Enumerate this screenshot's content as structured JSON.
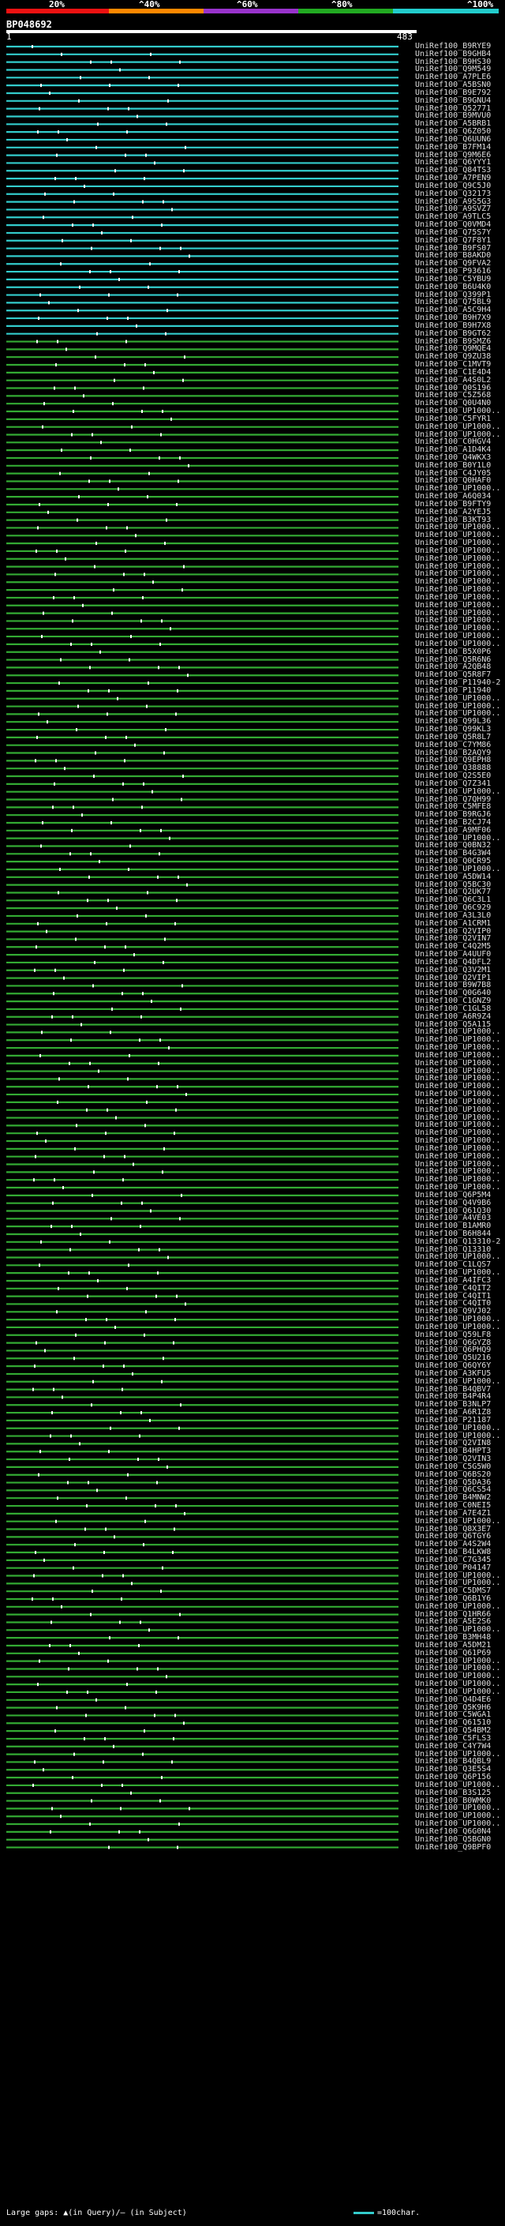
{
  "scale": {
    "labels": [
      "20%",
      "^40%",
      "^60%",
      "^80%",
      "^100%"
    ],
    "colors": [
      "#ee1111",
      "#ff8800",
      "#9933cc",
      "#22aa22",
      "#22cccc"
    ]
  },
  "query": {
    "id": "BP048692",
    "start": "1",
    "end": "483"
  },
  "colors": {
    "cyan": "#33cccc",
    "green": "#33aa33",
    "gap": "#ffffff",
    "arrow_pink": "#dd55dd",
    "arrow_green": "#44cc44"
  },
  "hits": [
    {
      "label": "UniRef100_B9RYE9",
      "c": "cyan"
    },
    {
      "label": "UniRef100_B9GHB4",
      "c": "cyan"
    },
    {
      "label": "UniRef100_B9HS30",
      "c": "cyan"
    },
    {
      "label": "UniRef100_Q9M549",
      "c": "cyan"
    },
    {
      "label": "UniRef100_A7PLE6",
      "c": "cyan"
    },
    {
      "label": "UniRef100_A5BSN0",
      "c": "cyan"
    },
    {
      "label": "UniRef100_B9E792",
      "c": "cyan"
    },
    {
      "label": "UniRef100_B9GNU4",
      "c": "cyan"
    },
    {
      "label": "UniRef100_Q52771",
      "c": "cyan"
    },
    {
      "label": "UniRef100_B9MVU0",
      "c": "cyan"
    },
    {
      "label": "UniRef100_A5BRB1",
      "c": "cyan"
    },
    {
      "label": "UniRef100_Q6Z050",
      "c": "cyan"
    },
    {
      "label": "UniRef100_Q6UUN6",
      "c": "cyan"
    },
    {
      "label": "UniRef100_B7FM14",
      "c": "cyan"
    },
    {
      "label": "UniRef100_Q9M6E6",
      "c": "cyan"
    },
    {
      "label": "UniRef100_Q6YYY1",
      "c": "cyan"
    },
    {
      "label": "UniRef100_Q84TS3",
      "c": "cyan"
    },
    {
      "label": "UniRef100_A7PEN9",
      "c": "cyan"
    },
    {
      "label": "UniRef100_Q9C5J0",
      "c": "cyan"
    },
    {
      "label": "UniRef100_Q32173",
      "c": "cyan"
    },
    {
      "label": "UniRef100_A9S5G3",
      "c": "cyan"
    },
    {
      "label": "UniRef100_A9SVZ7",
      "c": "cyan"
    },
    {
      "label": "UniRef100_A9TLC5",
      "c": "cyan"
    },
    {
      "label": "UniRef100_Q0VMD4",
      "c": "cyan"
    },
    {
      "label": "UniRef100_Q75S7Y",
      "c": "cyan"
    },
    {
      "label": "UniRef100_Q7F8Y1",
      "c": "cyan"
    },
    {
      "label": "UniRef100_B9FS07",
      "c": "cyan"
    },
    {
      "label": "UniRef100_B8AKD0",
      "c": "cyan"
    },
    {
      "label": "UniRef100_Q9FVA2",
      "c": "cyan"
    },
    {
      "label": "UniRef100_P93616",
      "c": "cyan"
    },
    {
      "label": "UniRef100_C5YBU9",
      "c": "cyan"
    },
    {
      "label": "UniRef100_B6U4K0",
      "c": "cyan"
    },
    {
      "label": "UniRef100_Q399P1",
      "c": "cyan"
    },
    {
      "label": "UniRef100_Q75BL9",
      "c": "cyan"
    },
    {
      "label": "UniRef100_A5C9H4",
      "c": "cyan"
    },
    {
      "label": "UniRef100_B9H7X9",
      "c": "cyan"
    },
    {
      "label": "UniRef100_B9H7X8",
      "c": "cyan"
    },
    {
      "label": "UniRef100_B9GT62",
      "c": "cyan"
    },
    {
      "label": "UniRef100_B9SMZ6",
      "c": "green"
    },
    {
      "label": "UniRef100_Q9MQE4",
      "c": "green"
    },
    {
      "label": "UniRef100_Q9ZU38",
      "c": "green"
    },
    {
      "label": "UniRef100_C1MVT9",
      "c": "green"
    },
    {
      "label": "UniRef100_C1E4D4",
      "c": "green"
    },
    {
      "label": "UniRef100_A4S0L2",
      "c": "green"
    },
    {
      "label": "UniRef100_Q0S196",
      "c": "green"
    },
    {
      "label": "UniRef100_C5Z568",
      "c": "green"
    },
    {
      "label": "UniRef100_Q0U4N0",
      "c": "green"
    },
    {
      "label": "UniRef100_UP1000..",
      "c": "green"
    },
    {
      "label": "UniRef100_C5FYR1",
      "c": "green"
    },
    {
      "label": "UniRef100_UP1000..",
      "c": "green"
    },
    {
      "label": "UniRef100_UP1000..",
      "c": "green"
    },
    {
      "label": "UniRef100_C0HGV4",
      "c": "green"
    },
    {
      "label": "UniRef100_A1D4K4",
      "c": "green"
    },
    {
      "label": "UniRef100_Q4WKX3",
      "c": "green"
    },
    {
      "label": "UniRef100_B0Y1L0",
      "c": "green"
    },
    {
      "label": "UniRef100_C4JY05",
      "c": "green"
    },
    {
      "label": "UniRef100_Q0HAF0",
      "c": "green"
    },
    {
      "label": "UniRef100_UP1000..",
      "c": "green"
    },
    {
      "label": "UniRef100_A6Q034",
      "c": "green"
    },
    {
      "label": "UniRef100_B9FTY9",
      "c": "green"
    },
    {
      "label": "UniRef100_A2YEJ5",
      "c": "green"
    },
    {
      "label": "UniRef100_B3KT93",
      "c": "green"
    },
    {
      "label": "UniRef100_UP1000..",
      "c": "green"
    },
    {
      "label": "UniRef100_UP1000..",
      "c": "green"
    },
    {
      "label": "UniRef100_UP1000..",
      "c": "green"
    },
    {
      "label": "UniRef100_UP1000..",
      "c": "green"
    },
    {
      "label": "UniRef100_UP1000..",
      "c": "green"
    },
    {
      "label": "UniRef100_UP1000..",
      "c": "green"
    },
    {
      "label": "UniRef100_UP1000..",
      "c": "green"
    },
    {
      "label": "UniRef100_UP1000..",
      "c": "green"
    },
    {
      "label": "UniRef100_UP1000..",
      "c": "green"
    },
    {
      "label": "UniRef100_UP1000..",
      "c": "green"
    },
    {
      "label": "UniRef100_UP1000..",
      "c": "green"
    },
    {
      "label": "UniRef100_UP1000..",
      "c": "green"
    },
    {
      "label": "UniRef100_UP1000..",
      "c": "green"
    },
    {
      "label": "UniRef100_UP1000..",
      "c": "green"
    },
    {
      "label": "UniRef100_UP1000..",
      "c": "green"
    },
    {
      "label": "UniRef100_UP1000..",
      "c": "green"
    },
    {
      "label": "UniRef100_B5X0P6",
      "c": "green"
    },
    {
      "label": "UniRef100_Q5R6N6",
      "c": "green"
    },
    {
      "label": "UniRef100_A2QB48",
      "c": "green"
    },
    {
      "label": "UniRef100_Q5R8F7",
      "c": "green"
    },
    {
      "label": "UniRef100_P11940-2",
      "c": "green"
    },
    {
      "label": "UniRef100_P11940",
      "c": "green"
    },
    {
      "label": "UniRef100_UP1000..",
      "c": "green"
    },
    {
      "label": "UniRef100_UP1000..",
      "c": "green"
    },
    {
      "label": "UniRef100_UP1000..",
      "c": "green"
    },
    {
      "label": "UniRef100_Q99L36",
      "c": "green"
    },
    {
      "label": "UniRef100_Q99KL3",
      "c": "green"
    },
    {
      "label": "UniRef100_Q5R8L7",
      "c": "green"
    },
    {
      "label": "UniRef100_C7YM86",
      "c": "green"
    },
    {
      "label": "UniRef100_B2AQY9",
      "c": "green"
    },
    {
      "label": "UniRef100_Q9EPH8",
      "c": "green"
    },
    {
      "label": "UniRef100_Q38888",
      "c": "green"
    },
    {
      "label": "UniRef100_Q2S5E0",
      "c": "green"
    },
    {
      "label": "UniRef100_Q7Z341",
      "c": "green"
    },
    {
      "label": "UniRef100_UP1000..",
      "c": "green"
    },
    {
      "label": "UniRef100_Q7QH99",
      "c": "green"
    },
    {
      "label": "UniRef100_C5MFE8",
      "c": "green"
    },
    {
      "label": "UniRef100_B9RGJ6",
      "c": "green"
    },
    {
      "label": "UniRef100_B2CJ74",
      "c": "green"
    },
    {
      "label": "UniRef100_A9MF06",
      "c": "green"
    },
    {
      "label": "UniRef100_UP1000..",
      "c": "green"
    },
    {
      "label": "UniRef100_Q0BN32",
      "c": "green"
    },
    {
      "label": "UniRef100_B4G3W4",
      "c": "green"
    },
    {
      "label": "UniRef100_Q0CR95",
      "c": "green"
    },
    {
      "label": "UniRef100_UP1000..",
      "c": "green"
    },
    {
      "label": "UniRef100_A5DW14",
      "c": "green"
    },
    {
      "label": "UniRef100_Q5BC30",
      "c": "green"
    },
    {
      "label": "UniRef100_Q2UK77",
      "c": "green"
    },
    {
      "label": "UniRef100_Q6C3L1",
      "c": "green"
    },
    {
      "label": "UniRef100_Q6C929",
      "c": "green"
    },
    {
      "label": "UniRef100_A3L3L0",
      "c": "green"
    },
    {
      "label": "UniRef100_A1CRM1",
      "c": "green"
    },
    {
      "label": "UniRef100_Q2VIP0",
      "c": "green"
    },
    {
      "label": "UniRef100_Q2VIN7",
      "c": "green"
    },
    {
      "label": "UniRef100_C4Q2M5",
      "c": "green"
    },
    {
      "label": "UniRef100_A4UUF0",
      "c": "green"
    },
    {
      "label": "UniRef100_Q4DFL2",
      "c": "green"
    },
    {
      "label": "UniRef100_Q3V2M1",
      "c": "green"
    },
    {
      "label": "UniRef100_Q2VIP1",
      "c": "green"
    },
    {
      "label": "UniRef100_B9W7B8",
      "c": "green"
    },
    {
      "label": "UniRef100_Q0G640",
      "c": "green"
    },
    {
      "label": "UniRef100_C1GNZ9",
      "c": "green"
    },
    {
      "label": "UniRef100_C1GL58",
      "c": "green"
    },
    {
      "label": "UniRef100_A6R9Z4",
      "c": "green"
    },
    {
      "label": "UniRef100_Q5A115",
      "c": "green"
    },
    {
      "label": "UniRef100_UP1000..",
      "c": "green"
    },
    {
      "label": "UniRef100_UP1000..",
      "c": "green"
    },
    {
      "label": "UniRef100_UP1000..",
      "c": "green"
    },
    {
      "label": "UniRef100_UP1000..",
      "c": "green"
    },
    {
      "label": "UniRef100_UP1000..",
      "c": "green"
    },
    {
      "label": "UniRef100_UP1000..",
      "c": "green"
    },
    {
      "label": "UniRef100_UP1000..",
      "c": "green"
    },
    {
      "label": "UniRef100_UP1000..",
      "c": "green"
    },
    {
      "label": "UniRef100_UP1000..",
      "c": "green"
    },
    {
      "label": "UniRef100_UP1000..",
      "c": "green"
    },
    {
      "label": "UniRef100_UP1000..",
      "c": "green"
    },
    {
      "label": "UniRef100_UP1000..",
      "c": "green"
    },
    {
      "label": "UniRef100_UP1000..",
      "c": "green"
    },
    {
      "label": "UniRef100_UP1000..",
      "c": "green"
    },
    {
      "label": "UniRef100_UP1000..",
      "c": "green"
    },
    {
      "label": "UniRef100_UP1000..",
      "c": "green"
    },
    {
      "label": "UniRef100_UP1000..",
      "c": "green"
    },
    {
      "label": "UniRef100_UP1000..",
      "c": "green"
    },
    {
      "label": "UniRef100_UP1000..",
      "c": "green"
    },
    {
      "label": "UniRef100_UP1000..",
      "c": "green"
    },
    {
      "label": "UniRef100_UP1000..",
      "c": "green"
    },
    {
      "label": "UniRef100_Q6P5M4",
      "c": "green"
    },
    {
      "label": "UniRef100_Q4V9B6",
      "c": "green"
    },
    {
      "label": "UniRef100_Q61Q30",
      "c": "green"
    },
    {
      "label": "UniRef100_A4VE03",
      "c": "green"
    },
    {
      "label": "UniRef100_B1AMR0",
      "c": "green"
    },
    {
      "label": "UniRef100_B6H844",
      "c": "green"
    },
    {
      "label": "UniRef100_Q13310-2",
      "c": "green"
    },
    {
      "label": "UniRef100_Q13310",
      "c": "green"
    },
    {
      "label": "UniRef100_UP1000..",
      "c": "green"
    },
    {
      "label": "UniRef100_C1LQS7",
      "c": "green"
    },
    {
      "label": "UniRef100_UP1000..",
      "c": "green"
    },
    {
      "label": "UniRef100_A4IFC3",
      "c": "green"
    },
    {
      "label": "UniRef100_C4QIT2",
      "c": "green"
    },
    {
      "label": "UniRef100_C4QIT1",
      "c": "green"
    },
    {
      "label": "UniRef100_C4QIT0",
      "c": "green"
    },
    {
      "label": "UniRef100_Q9VJ02",
      "c": "green"
    },
    {
      "label": "UniRef100_UP1000..",
      "c": "green"
    },
    {
      "label": "UniRef100_UP1000..",
      "c": "green"
    },
    {
      "label": "UniRef100_Q59LF8",
      "c": "green"
    },
    {
      "label": "UniRef100_Q6GYZ8",
      "c": "green"
    },
    {
      "label": "UniRef100_Q6PHQ9",
      "c": "green"
    },
    {
      "label": "UniRef100_Q5U216",
      "c": "green"
    },
    {
      "label": "UniRef100_Q6QY6Y",
      "c": "green"
    },
    {
      "label": "UniRef100_A3KFU5",
      "c": "green"
    },
    {
      "label": "UniRef100_UP1000..",
      "c": "green"
    },
    {
      "label": "UniRef100_B4QBV7",
      "c": "green"
    },
    {
      "label": "UniRef100_B4P4R4",
      "c": "green"
    },
    {
      "label": "UniRef100_B3NLP7",
      "c": "green"
    },
    {
      "label": "UniRef100_A6R1Z8",
      "c": "green"
    },
    {
      "label": "UniRef100_P21187",
      "c": "green"
    },
    {
      "label": "UniRef100_UP1000..",
      "c": "green"
    },
    {
      "label": "UniRef100_UP1000..",
      "c": "green"
    },
    {
      "label": "UniRef100_Q2VIN8",
      "c": "green"
    },
    {
      "label": "UniRef100_B4HPT3",
      "c": "green"
    },
    {
      "label": "UniRef100_Q2VIN3",
      "c": "green"
    },
    {
      "label": "UniRef100_C5G5W0",
      "c": "green"
    },
    {
      "label": "UniRef100_Q6BS20",
      "c": "green"
    },
    {
      "label": "UniRef100_Q5DA36",
      "c": "green"
    },
    {
      "label": "UniRef100_Q6CS54",
      "c": "green"
    },
    {
      "label": "UniRef100_B4MNW2",
      "c": "green"
    },
    {
      "label": "UniRef100_C0NEI5",
      "c": "green"
    },
    {
      "label": "UniRef100_A7E4Z1",
      "c": "green"
    },
    {
      "label": "UniRef100_UP1000..",
      "c": "green"
    },
    {
      "label": "UniRef100_Q8X3E7",
      "c": "green"
    },
    {
      "label": "UniRef100_Q6TGY6",
      "c": "green"
    },
    {
      "label": "UniRef100_A4S2W4",
      "c": "green"
    },
    {
      "label": "UniRef100_B4LKW8",
      "c": "green"
    },
    {
      "label": "UniRef100_C7G345",
      "c": "green"
    },
    {
      "label": "UniRef100_P04147",
      "c": "green"
    },
    {
      "label": "UniRef100_UP1000..",
      "c": "green"
    },
    {
      "label": "UniRef100_UP1000..",
      "c": "green"
    },
    {
      "label": "UniRef100_C5DMS7",
      "c": "green"
    },
    {
      "label": "UniRef100_Q6B1Y6",
      "c": "green"
    },
    {
      "label": "UniRef100_UP1000..",
      "c": "green"
    },
    {
      "label": "UniRef100_Q1HR66",
      "c": "green"
    },
    {
      "label": "UniRef100_A5E2S6",
      "c": "green"
    },
    {
      "label": "UniRef100_UP1000..",
      "c": "green"
    },
    {
      "label": "UniRef100_B3MH48",
      "c": "green"
    },
    {
      "label": "UniRef100_A5DM21",
      "c": "green"
    },
    {
      "label": "UniRef100_Q61P69",
      "c": "green"
    },
    {
      "label": "UniRef100_UP1000..",
      "c": "green"
    },
    {
      "label": "UniRef100_UP1000..",
      "c": "green"
    },
    {
      "label": "UniRef100_UP1000..",
      "c": "green"
    },
    {
      "label": "UniRef100_UP1000..",
      "c": "green"
    },
    {
      "label": "UniRef100_UP1000..",
      "c": "green"
    },
    {
      "label": "UniRef100_Q4D4E6",
      "c": "green"
    },
    {
      "label": "UniRef100_Q5K9H6",
      "c": "green"
    },
    {
      "label": "UniRef100_C5WGA1",
      "c": "green"
    },
    {
      "label": "UniRef100_Q61510",
      "c": "green"
    },
    {
      "label": "UniRef100_Q54BM2",
      "c": "green"
    },
    {
      "label": "UniRef100_C5FLS3",
      "c": "green"
    },
    {
      "label": "UniRef100_C4Y7W4",
      "c": "green"
    },
    {
      "label": "UniRef100_UP1000..",
      "c": "green"
    },
    {
      "label": "UniRef100_B4QBL9",
      "c": "green"
    },
    {
      "label": "UniRef100_Q3E5S4",
      "c": "green"
    },
    {
      "label": "UniRef100_Q6P156",
      "c": "green"
    },
    {
      "label": "UniRef100_UP1000..",
      "c": "green"
    },
    {
      "label": "UniRef100_B3S125",
      "c": "green"
    },
    {
      "label": "UniRef100_B0WMK0",
      "c": "green"
    },
    {
      "label": "UniRef100_UP1000..",
      "c": "green"
    },
    {
      "label": "UniRef100_UP1000..",
      "c": "green"
    },
    {
      "label": "UniRef100_UP1000..",
      "c": "green"
    },
    {
      "label": "UniRef100_Q6G0N4",
      "c": "green"
    },
    {
      "label": "UniRef100_Q5BGN0",
      "c": "green"
    },
    {
      "label": "UniRef100_Q9BPF0",
      "c": "green"
    }
  ],
  "footer": {
    "left": "Large gaps: ▲(in Query)/— (in Subject)",
    "right": "=100char."
  }
}
